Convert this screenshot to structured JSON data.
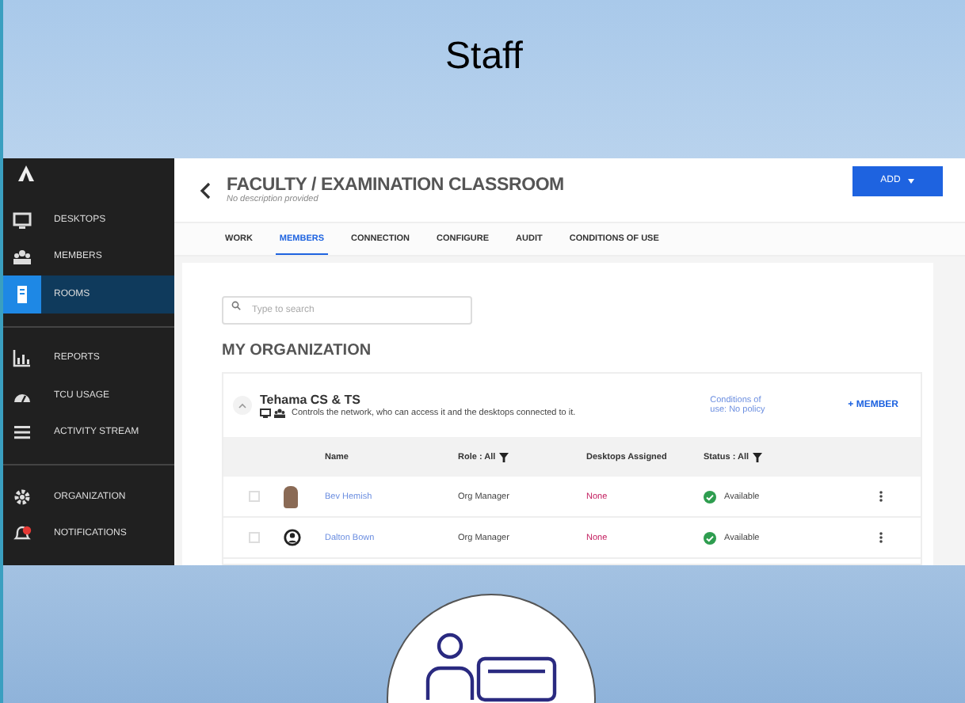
{
  "slide": {
    "title": "Staff"
  },
  "sidebar": {
    "groups": [
      {
        "items": [
          {
            "label": "DESKTOPS",
            "selected": false
          },
          {
            "label": "MEMBERS",
            "selected": false
          },
          {
            "label": "ROOMS",
            "selected": true
          }
        ]
      },
      {
        "items": [
          {
            "label": "REPORTS",
            "selected": false
          },
          {
            "label": "TCU USAGE",
            "selected": false
          },
          {
            "label": "ACTIVITY STREAM",
            "selected": false
          }
        ]
      },
      {
        "items": [
          {
            "label": "ORGANIZATION",
            "selected": false
          },
          {
            "label": "NOTIFICATIONS",
            "selected": false
          }
        ]
      }
    ]
  },
  "header": {
    "title": "FACULTY / EXAMINATION CLASSROOM",
    "subtitle": "No description provided",
    "add_button": "ADD"
  },
  "tabs": [
    {
      "label": "WORK",
      "selected": false
    },
    {
      "label": "MEMBERS",
      "selected": true
    },
    {
      "label": "CONNECTION",
      "selected": false
    },
    {
      "label": "CONFIGURE",
      "selected": false
    },
    {
      "label": "AUDIT",
      "selected": false
    },
    {
      "label": "CONDITIONS OF USE",
      "selected": false
    }
  ],
  "search": {
    "placeholder": "Type to search"
  },
  "section_title": "MY ORGANIZATION",
  "org": {
    "name": "Tehama CS & TS",
    "expanded": true,
    "description": "Controls the network, who can access it and the desktops connected to it.",
    "conditions_link": "Conditions of use: No policy",
    "add_member": "+ MEMBER"
  },
  "table": {
    "columns": [
      {
        "label": "Name",
        "filter": false
      },
      {
        "label": "Role : All",
        "filter": true
      },
      {
        "label": "Desktops Assigned",
        "filter": false
      },
      {
        "label": "Status : All",
        "filter": true
      }
    ],
    "rows": [
      {
        "checked": false,
        "avatar": {
          "kind": "photo"
        },
        "name": "Bev Hemish",
        "role": "Org Manager",
        "desktops": "None",
        "status": "Available"
      },
      {
        "checked": false,
        "avatar": {
          "kind": "default"
        },
        "name": "Dalton Bown",
        "role": "Org Manager",
        "desktops": "None",
        "status": "Available"
      }
    ]
  }
}
